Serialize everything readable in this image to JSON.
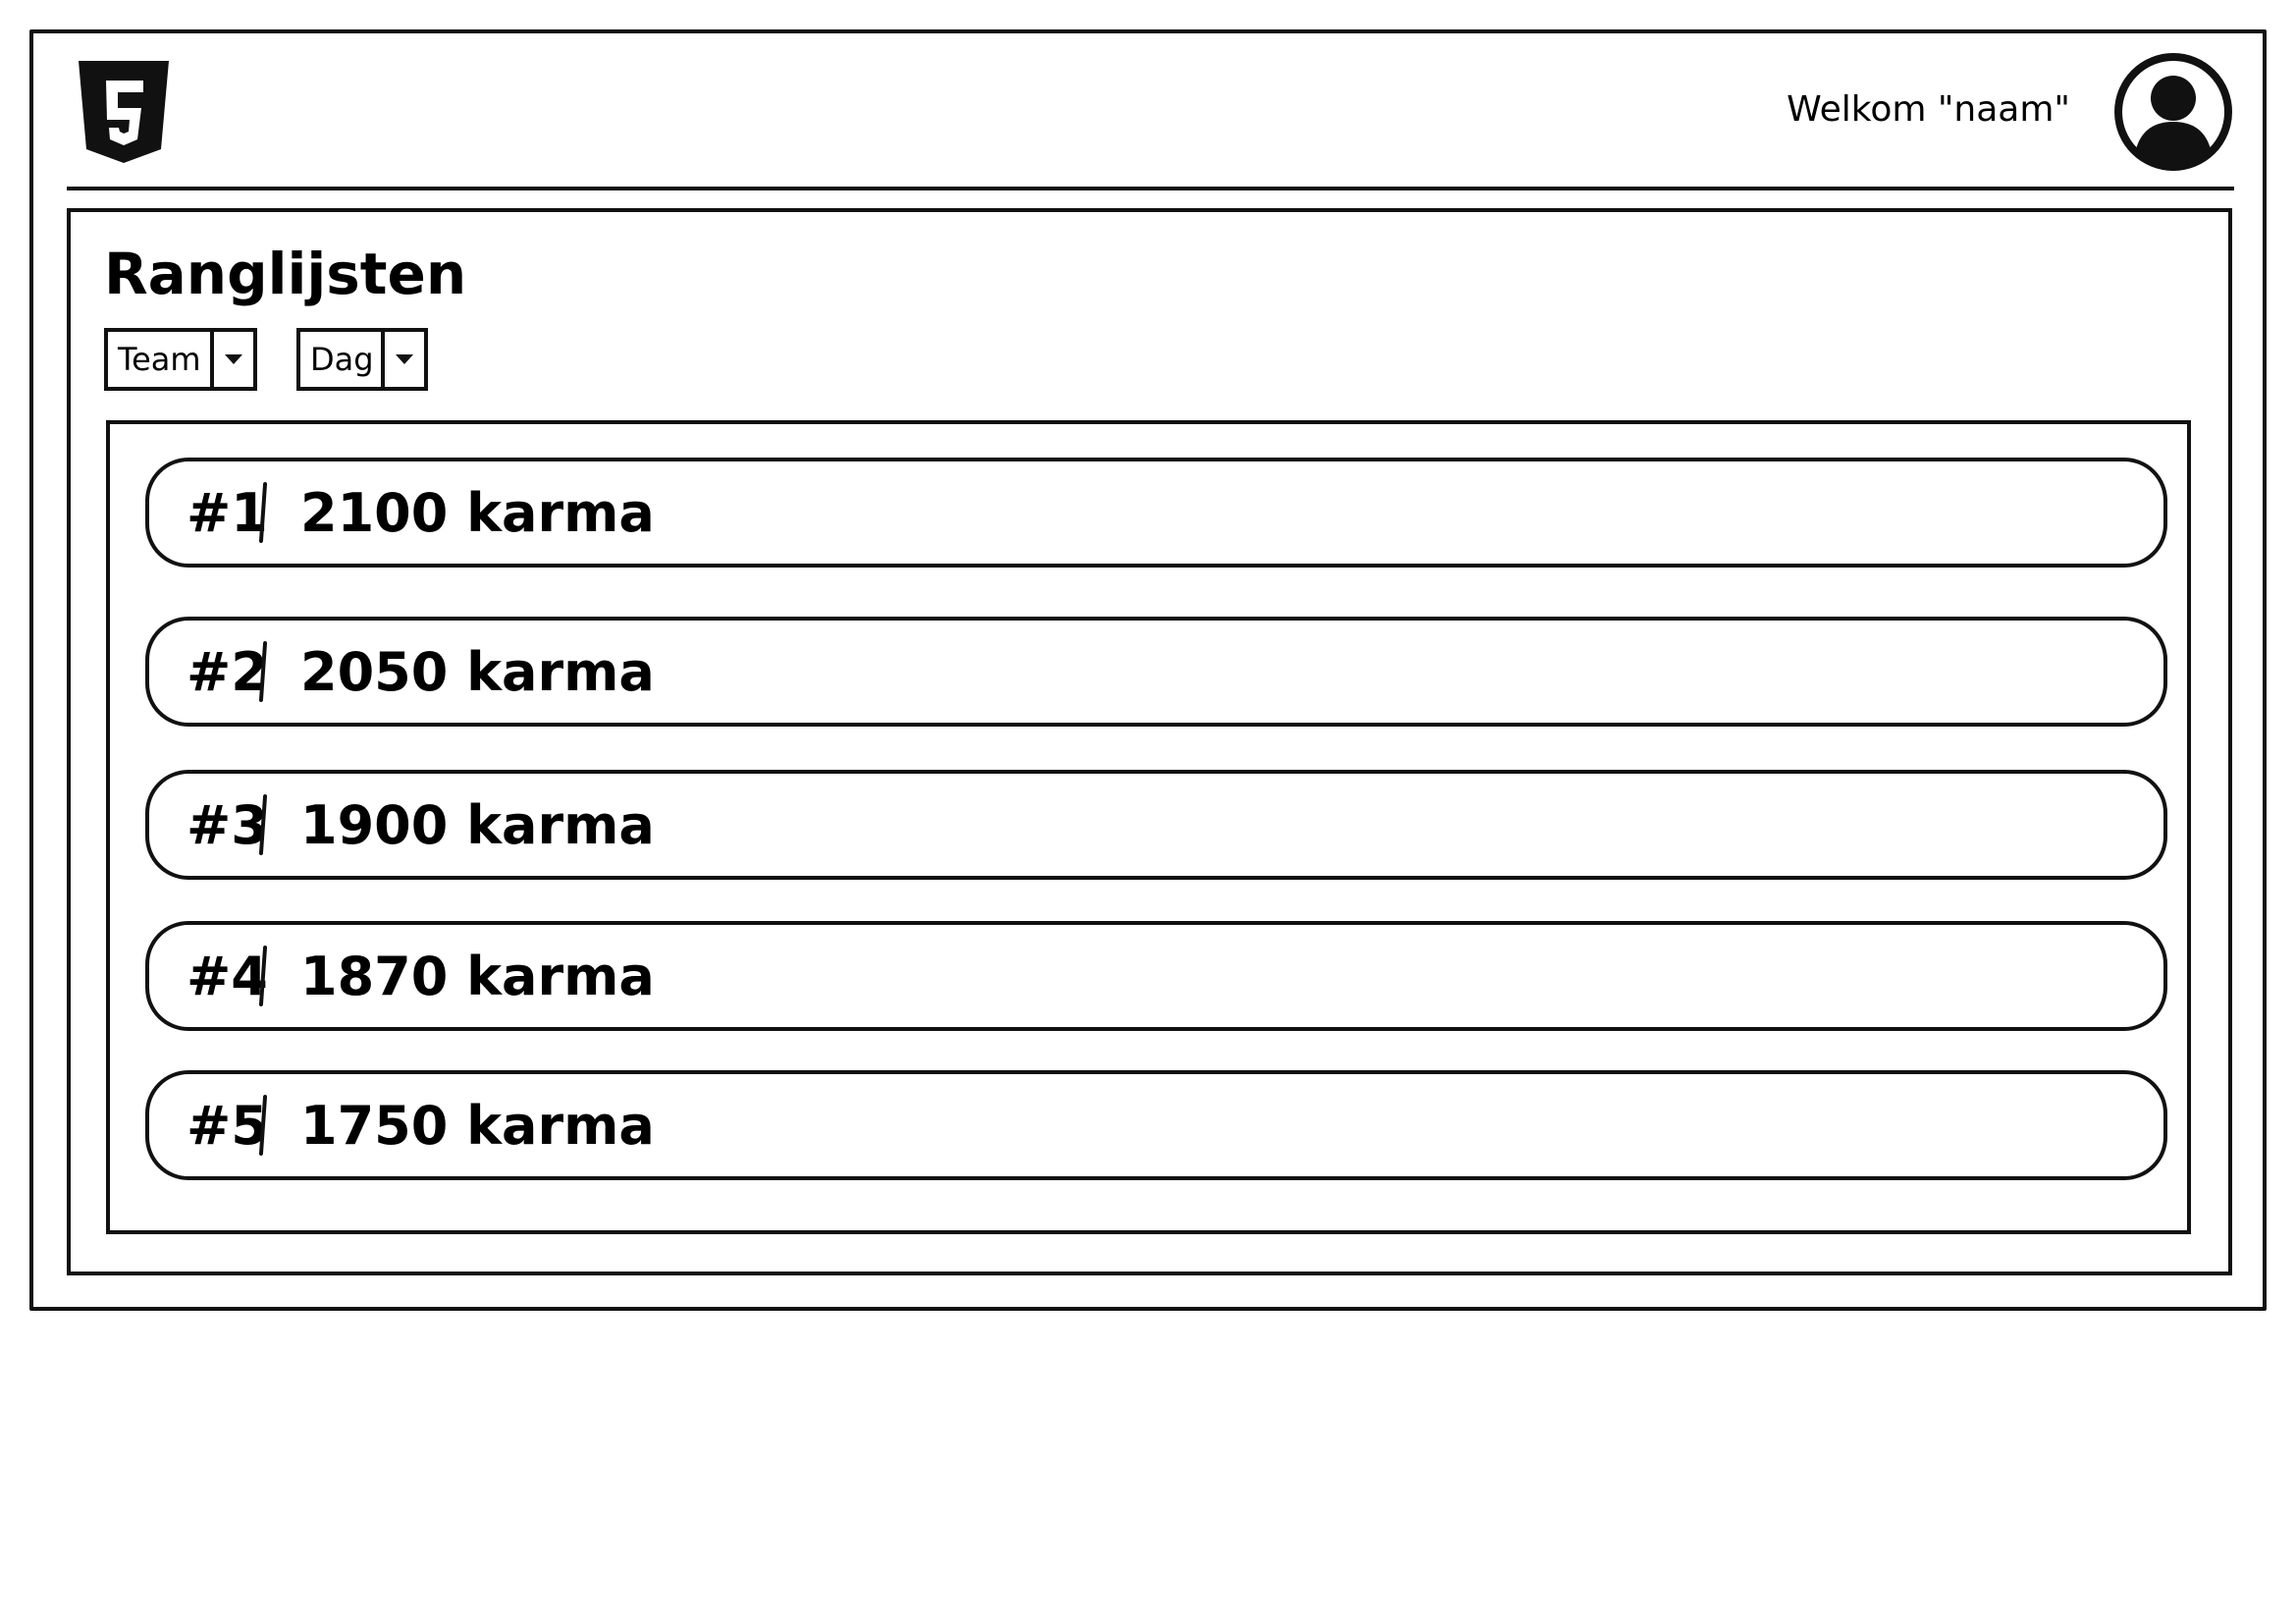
{
  "header": {
    "logo_icon": "html5-logo-icon",
    "welcome_text": "Welkom \"naam\"",
    "avatar_icon": "user-avatar-icon"
  },
  "main": {
    "title": "Ranglijsten",
    "filters": {
      "group_select": {
        "value": "Team",
        "icon": "chevron-down-icon"
      },
      "period_select": {
        "value": "Dag",
        "icon": "chevron-down-icon"
      }
    },
    "rankings": [
      {
        "rank": "#1",
        "score": "2100 karma"
      },
      {
        "rank": "#2",
        "score": "2050 karma"
      },
      {
        "rank": "#3",
        "score": "1900 karma"
      },
      {
        "rank": "#4",
        "score": "1870 karma"
      },
      {
        "rank": "#5",
        "score": "1750 karma"
      }
    ]
  },
  "colors": {
    "stroke": "#111111",
    "background": "#ffffff"
  }
}
